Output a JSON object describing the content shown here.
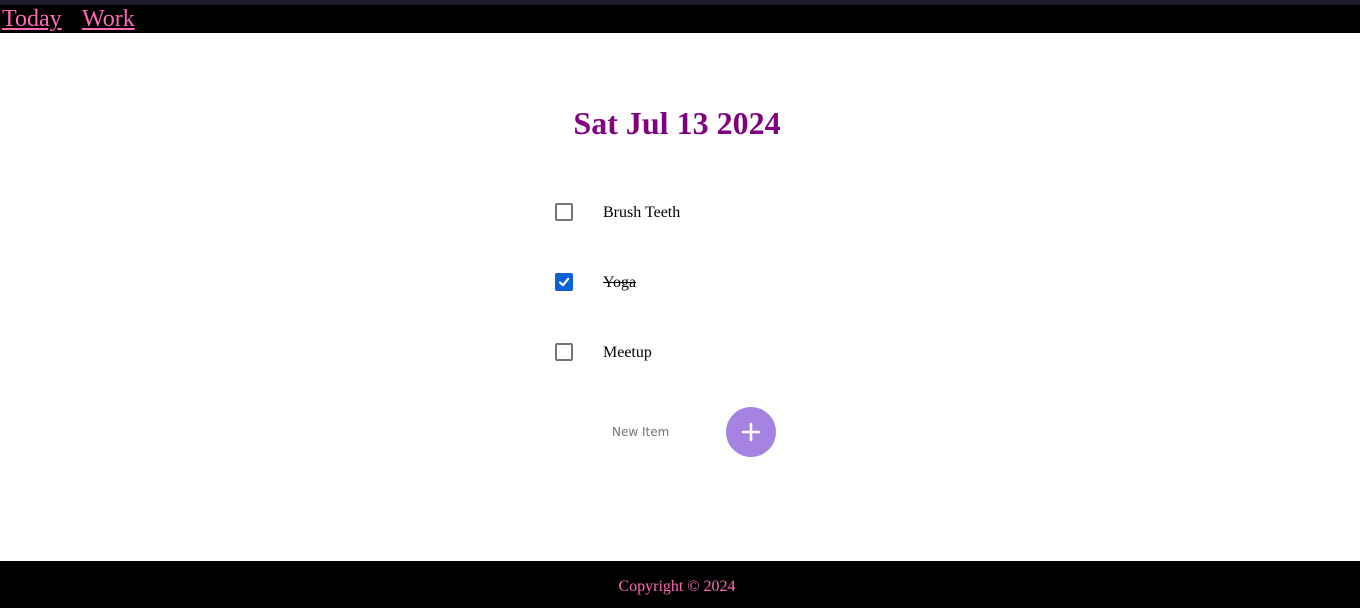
{
  "nav": {
    "items": [
      {
        "label": "Today"
      },
      {
        "label": "Work"
      }
    ],
    "link_color": "#ff69b4"
  },
  "header": {
    "date": "Sat Jul 13 2024",
    "color": "#800080"
  },
  "tasks": [
    {
      "label": "Brush Teeth",
      "checked": false
    },
    {
      "label": "Yoga",
      "checked": true
    },
    {
      "label": "Meetup",
      "checked": false
    }
  ],
  "new_item": {
    "placeholder": "New Item",
    "add_button_icon": "plus-icon",
    "add_button_color": "#a683e3"
  },
  "footer": {
    "text": "Copyright © 2024",
    "color": "#ff69b4"
  },
  "colors": {
    "checkbox_checked": "#0b61d8"
  }
}
